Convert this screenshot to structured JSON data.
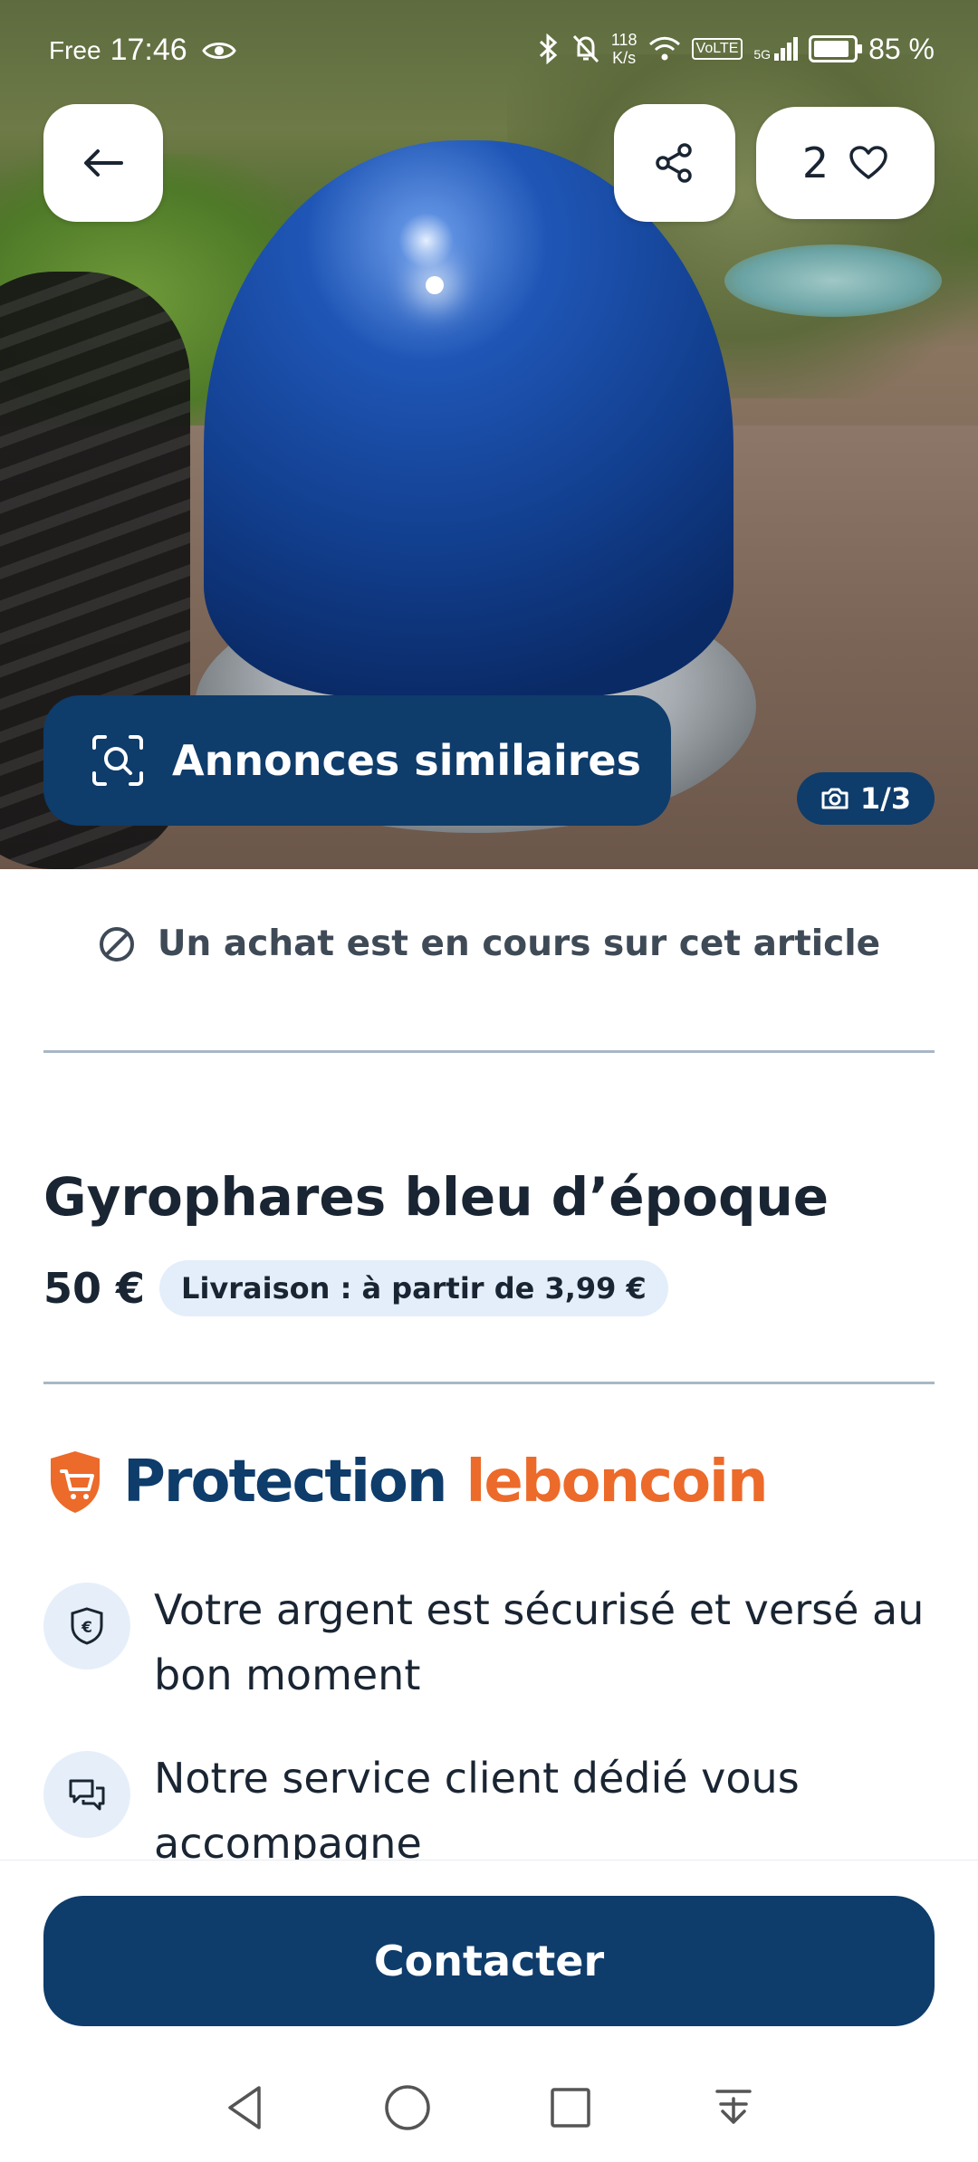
{
  "status_bar": {
    "carrier": "Free",
    "time": "17:46",
    "speed_value": "118",
    "speed_unit": "K/s",
    "network": "5G",
    "volte": "VoLTE",
    "battery": "85 %"
  },
  "hero": {
    "favorites_count": "2",
    "similar_label": "Annonces similaires",
    "photo_counter": "1/3"
  },
  "notice": {
    "text": "Un achat est en cours sur cet article"
  },
  "listing": {
    "title": "Gyrophares bleu d’époque",
    "price": "50 €",
    "delivery": "Livraison : à partir de 3,99 €"
  },
  "protection": {
    "word1": "Protection",
    "word2": "leboncoin",
    "features": [
      {
        "icon": "shield-euro-icon",
        "text": "Votre argent est sécurisé et versé au bon moment"
      },
      {
        "icon": "chat-bubbles-icon",
        "text": "Notre service client dédié vous accompagne"
      }
    ]
  },
  "cta": {
    "contact_label": "Contacter"
  },
  "colors": {
    "brand_navy": "#0e3c6b",
    "brand_orange": "#ec6a2a",
    "badge_bg": "#e3eefa"
  }
}
